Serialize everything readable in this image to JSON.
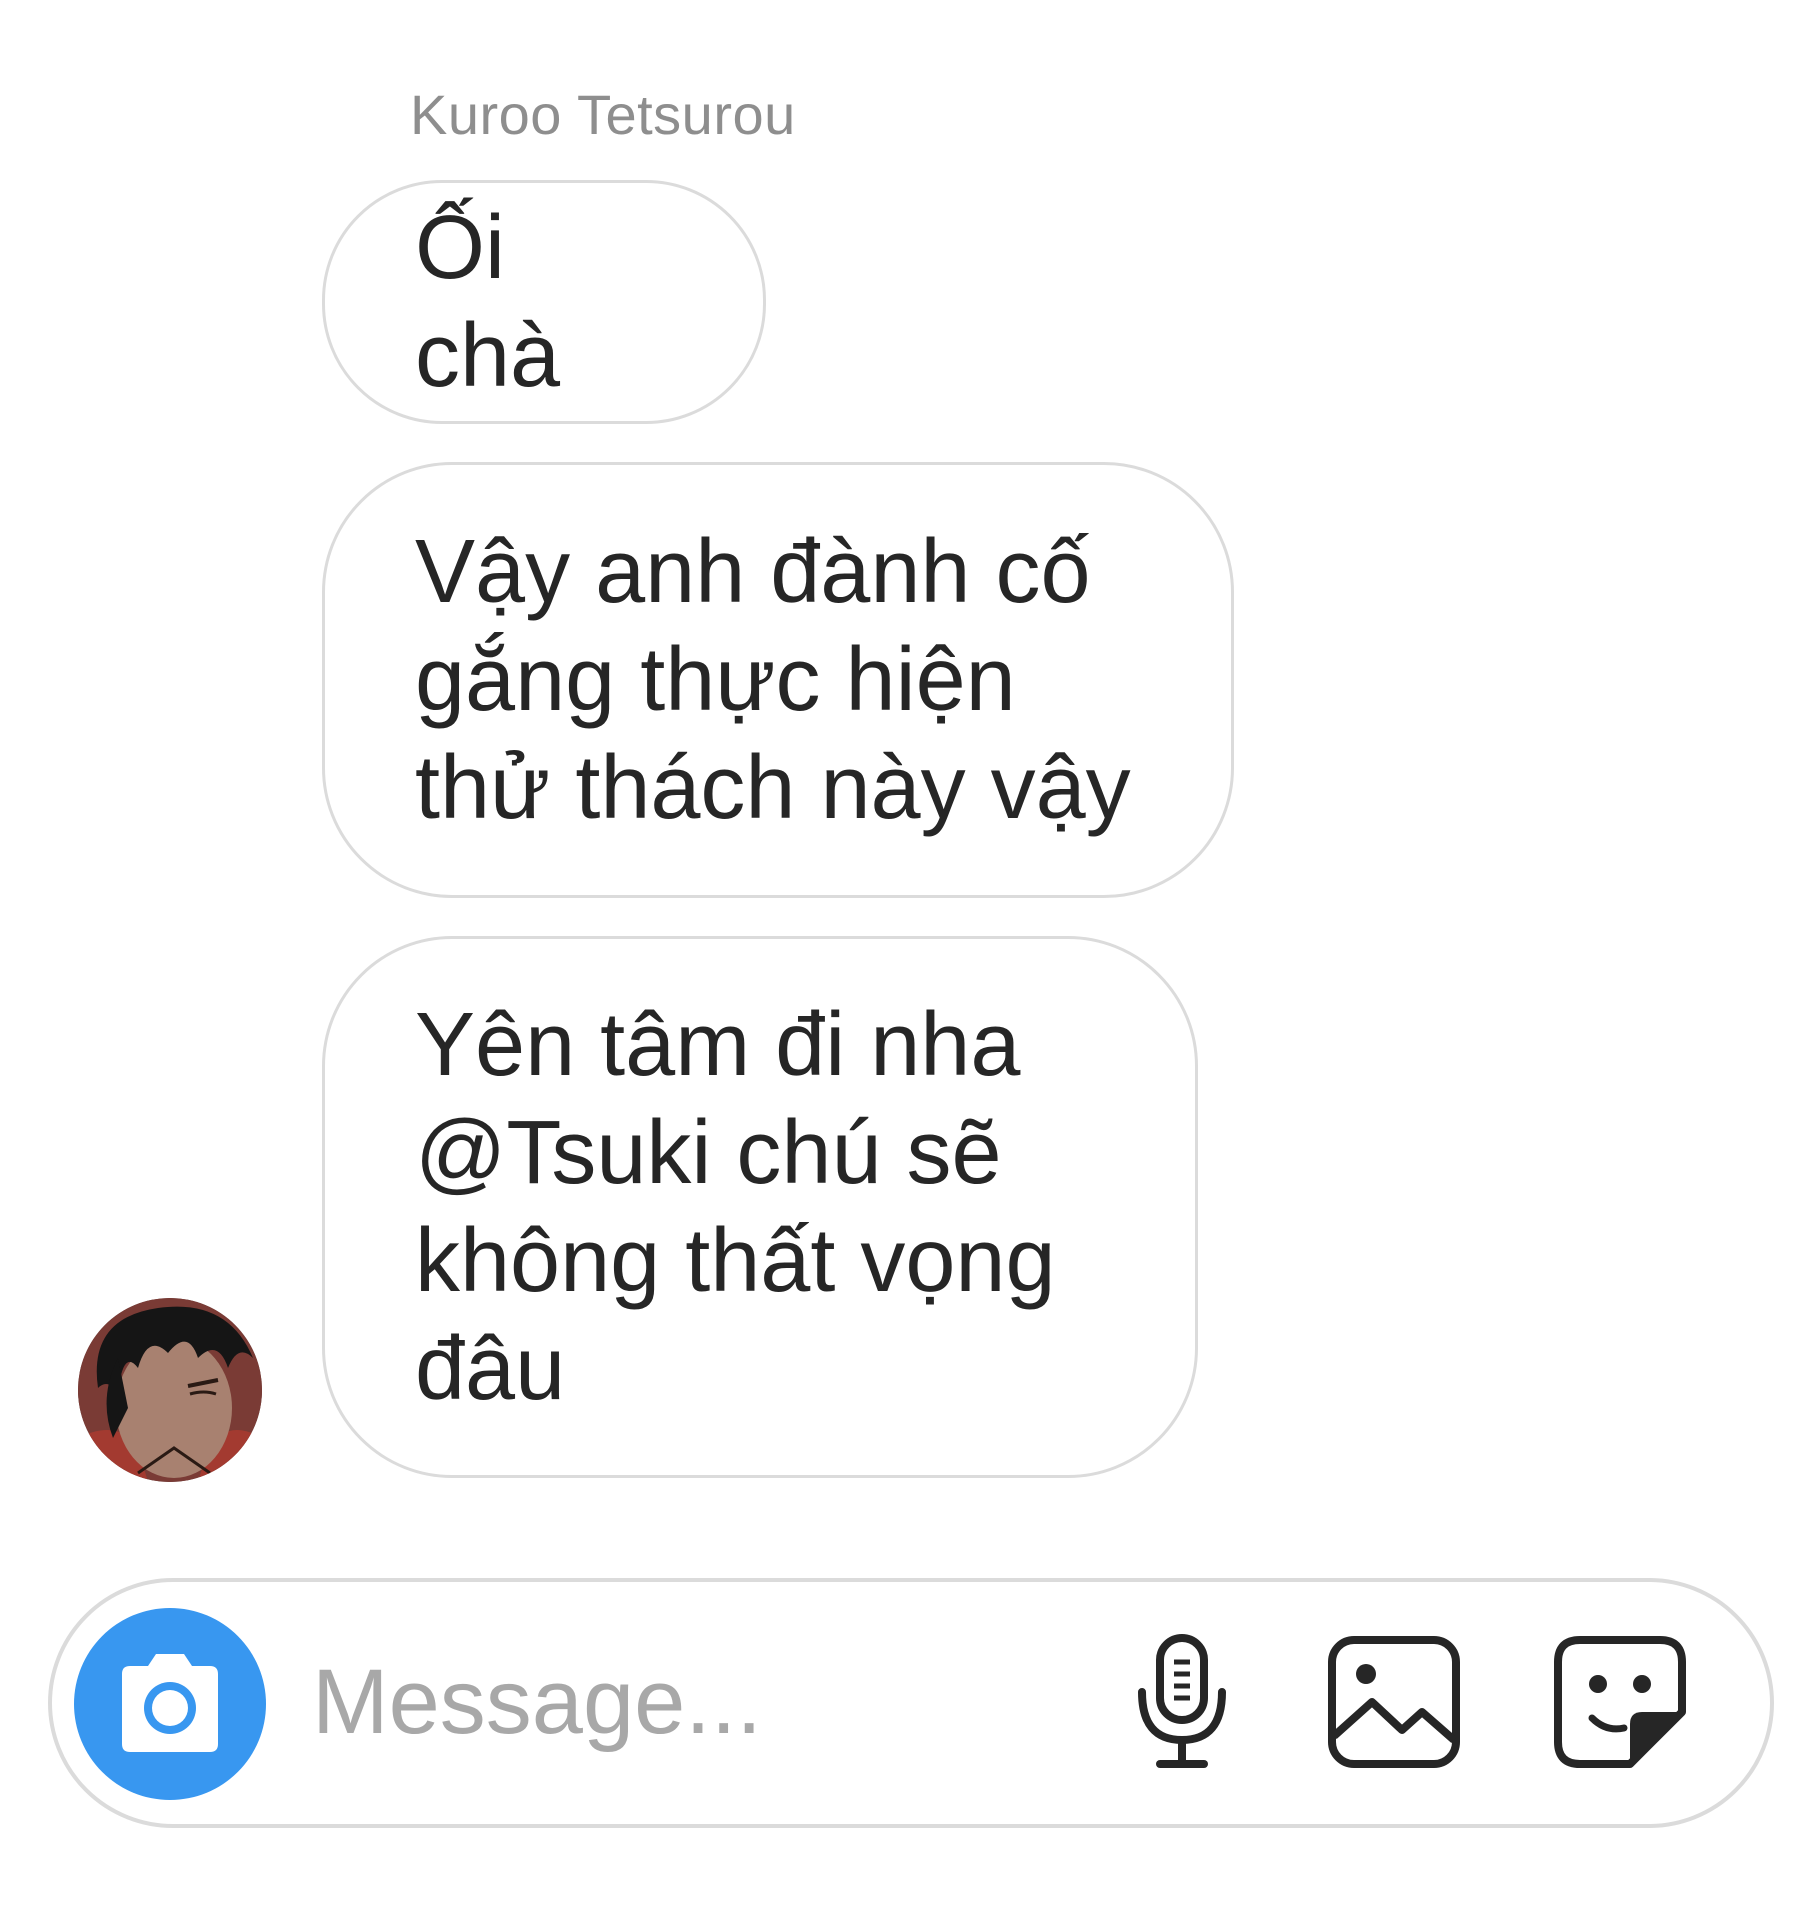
{
  "thread": {
    "sender_name": "Kuroo Tetsurou",
    "messages": [
      {
        "text": "Ối chà"
      },
      {
        "text": "Vậy anh đành cố\ngắng thực hiện\nthử thách này vậy"
      },
      {
        "text": "Yên tâm đi nha\n@Tsuki chú sẽ\nkhông thất vọng\nđâu"
      }
    ]
  },
  "composer": {
    "placeholder": "Message...",
    "value": "",
    "icons": {
      "camera": "camera-icon",
      "mic": "microphone-icon",
      "gallery": "image-gallery-icon",
      "sticker": "sticker-icon"
    },
    "camera_color": "#3897f0"
  },
  "colors": {
    "bubble_border": "#dbdbdb",
    "text": "#262626",
    "muted": "#8e8e8e"
  }
}
